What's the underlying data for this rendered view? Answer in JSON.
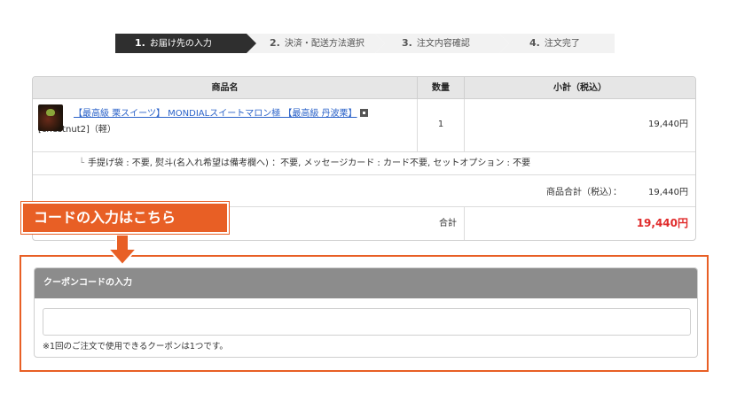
{
  "steps": [
    {
      "num": "1.",
      "label": "お届け先の入力"
    },
    {
      "num": "2.",
      "label": "決済・配送方法選択"
    },
    {
      "num": "3.",
      "label": "注文内容確認"
    },
    {
      "num": "4.",
      "label": "注文完了"
    }
  ],
  "cart": {
    "headers": {
      "name": "商品名",
      "qty": "数量",
      "subtotal": "小計（税込）"
    },
    "item": {
      "link_text": "【最高級 栗スイーツ】 MONDIALスイートマロン極 【最高級 丹波栗】",
      "suffix": "[chestnut2]（軽）",
      "qty": "1",
      "subtotal": "19,440円"
    },
    "option": "手提げ袋 : 不要, 熨斗(名入れ希望は備考欄へ) ：不要, メッセージカード : カード不要, セットオプション : 不要",
    "product_total_label": "商品合計（税込）：",
    "product_total_value": "19,440円",
    "grand_total_label": "合計",
    "grand_total_value": "19,440円"
  },
  "callout": {
    "text": "コードの入力はこちら"
  },
  "coupon": {
    "title": "クーポンコードの入力",
    "input_value": "",
    "input_placeholder": "",
    "note": "※1回のご注文で使用できるクーポンは1つです。"
  },
  "colors": {
    "accent": "#e85f25",
    "step_active": "#2f2f2f",
    "price_red": "#e02a2a",
    "link": "#2a62c9"
  }
}
